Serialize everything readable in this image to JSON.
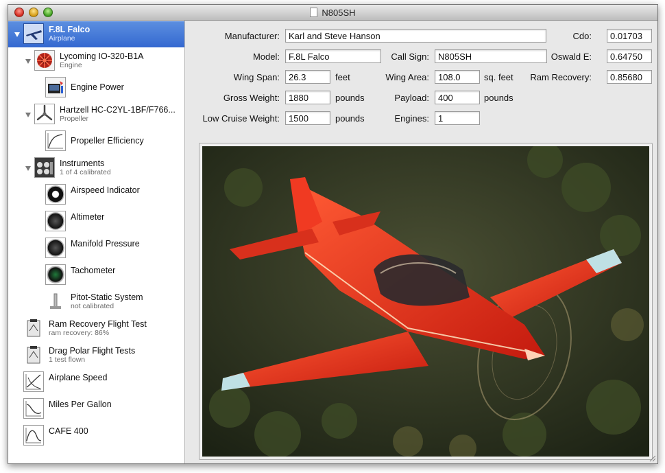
{
  "window": {
    "title": "N805SH"
  },
  "sidebar": {
    "items": [
      {
        "label": "F.8L Falco",
        "sub": "Airplane",
        "icon": "airplane-icon"
      },
      {
        "label": "Lycoming IO-320-B1A",
        "sub": "Engine",
        "icon": "engine-icon"
      },
      {
        "label": "Engine Power",
        "sub": "",
        "icon": "engine-power-icon"
      },
      {
        "label": "Hartzell HC-C2YL-1BF/F766...",
        "sub": "Propeller",
        "icon": "propeller-icon"
      },
      {
        "label": "Propeller Efficiency",
        "sub": "",
        "icon": "efficiency-curve-icon"
      },
      {
        "label": "Instruments",
        "sub": "1 of 4 calibrated",
        "icon": "instrument-panel-icon"
      },
      {
        "label": "Airspeed Indicator",
        "sub": "",
        "icon": "airspeed-gauge-icon"
      },
      {
        "label": "Altimeter",
        "sub": "",
        "icon": "altimeter-gauge-icon"
      },
      {
        "label": "Manifold Pressure",
        "sub": "",
        "icon": "manifold-gauge-icon"
      },
      {
        "label": "Tachometer",
        "sub": "",
        "icon": "tachometer-gauge-icon"
      },
      {
        "label": "Pitot-Static System",
        "sub": "not calibrated",
        "icon": "pitot-tube-icon"
      },
      {
        "label": "Ram Recovery Flight Test",
        "sub": "ram recovery: 86%",
        "icon": "clipboard-icon"
      },
      {
        "label": "Drag Polar Flight Tests",
        "sub": "1 test flown",
        "icon": "clipboard-icon"
      },
      {
        "label": "Airplane Speed",
        "sub": "",
        "icon": "speed-curve-icon"
      },
      {
        "label": "Miles Per Gallon",
        "sub": "",
        "icon": "mpg-curve-icon"
      },
      {
        "label": "CAFE 400",
        "sub": "",
        "icon": "cafe-curve-icon"
      }
    ]
  },
  "form": {
    "manufacturer": {
      "label": "Manufacturer:",
      "value": "Karl and Steve Hanson"
    },
    "model": {
      "label": "Model:",
      "value": "F.8L Falco"
    },
    "call_sign": {
      "label": "Call Sign:",
      "value": "N805SH"
    },
    "cdo": {
      "label": "Cdo:",
      "value": "0.01703"
    },
    "oswald": {
      "label": "Oswald E:",
      "value": "0.64750"
    },
    "ram": {
      "label": "Ram Recovery:",
      "value": "0.85680"
    },
    "wing_span": {
      "label": "Wing Span:",
      "value": "26.3",
      "unit": "feet"
    },
    "wing_area": {
      "label": "Wing Area:",
      "value": "108.0",
      "unit": "sq. feet"
    },
    "gross_weight": {
      "label": "Gross Weight:",
      "value": "1880",
      "unit": "pounds"
    },
    "payload": {
      "label": "Payload:",
      "value": "400",
      "unit": "pounds"
    },
    "low_cruise": {
      "label": "Low Cruise Weight:",
      "value": "1500",
      "unit": "pounds"
    },
    "engines": {
      "label": "Engines:",
      "value": "1"
    }
  },
  "colors": {
    "selection": "#3468d0",
    "airplane": "#e8321c"
  }
}
